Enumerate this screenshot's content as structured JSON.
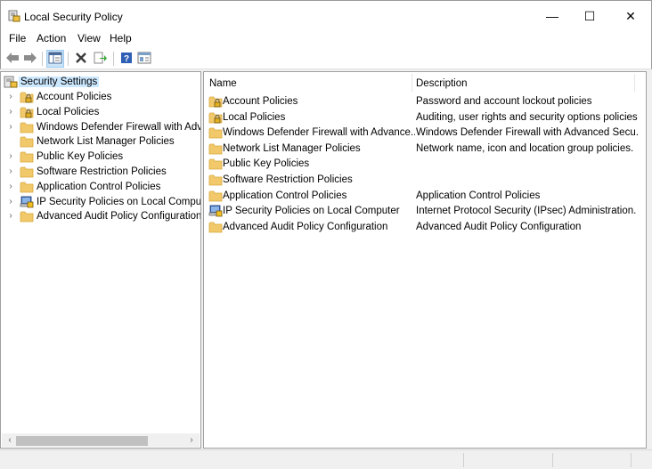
{
  "window": {
    "title": "Local Security Policy",
    "controls": {
      "minimize": "—",
      "maximize": "☐",
      "close": "✕"
    }
  },
  "menu": {
    "items": [
      "File",
      "Action",
      "View",
      "Help"
    ]
  },
  "toolbar": {
    "buttons": [
      "back-arrow-icon",
      "forward-arrow-icon",
      "show-hide-tree-icon",
      "delete-icon",
      "export-list-icon",
      "help-icon",
      "properties-icon"
    ]
  },
  "tree": {
    "root": "Security Settings",
    "items": [
      {
        "label": "Account Policies",
        "icon": "folder-lock-icon",
        "expandable": true
      },
      {
        "label": "Local Policies",
        "icon": "folder-lock-icon",
        "expandable": true
      },
      {
        "label": "Windows Defender Firewall with Advar",
        "icon": "folder-icon",
        "expandable": true
      },
      {
        "label": "Network List Manager Policies",
        "icon": "folder-icon",
        "expandable": false
      },
      {
        "label": "Public Key Policies",
        "icon": "folder-icon",
        "expandable": true
      },
      {
        "label": "Software Restriction Policies",
        "icon": "folder-icon",
        "expandable": true
      },
      {
        "label": "Application Control Policies",
        "icon": "folder-icon",
        "expandable": true
      },
      {
        "label": "IP Security Policies on Local Computer",
        "icon": "ipsec-icon",
        "expandable": true
      },
      {
        "label": "Advanced Audit Policy Configuration",
        "icon": "folder-icon",
        "expandable": true
      }
    ]
  },
  "list": {
    "columns": {
      "name": "Name",
      "description": "Description"
    },
    "rows": [
      {
        "name": "Account Policies",
        "description": "Password and account lockout policies",
        "icon": "folder-lock-icon"
      },
      {
        "name": "Local Policies",
        "description": "Auditing, user rights and security options policies",
        "icon": "folder-lock-icon"
      },
      {
        "name": "Windows Defender Firewall with Advance...",
        "description": "Windows Defender Firewall with Advanced Secu...",
        "icon": "folder-icon"
      },
      {
        "name": "Network List Manager Policies",
        "description": "Network name, icon and location group policies.",
        "icon": "folder-icon"
      },
      {
        "name": "Public Key Policies",
        "description": "",
        "icon": "folder-icon"
      },
      {
        "name": "Software Restriction Policies",
        "description": "",
        "icon": "folder-icon"
      },
      {
        "name": "Application Control Policies",
        "description": "Application Control Policies",
        "icon": "folder-icon"
      },
      {
        "name": "IP Security Policies on Local Computer",
        "description": "Internet Protocol Security (IPsec) Administration. ...",
        "icon": "ipsec-icon"
      },
      {
        "name": "Advanced Audit Policy Configuration",
        "description": "Advanced Audit Policy Configuration",
        "icon": "folder-icon"
      }
    ]
  },
  "colors": {
    "folder": "#f1c96b",
    "folder_dark": "#d9a93a",
    "selection": "#cce8ff"
  }
}
